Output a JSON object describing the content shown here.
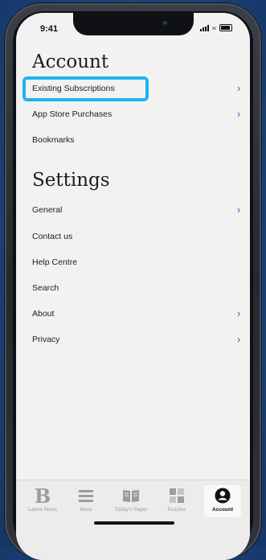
{
  "status_bar": {
    "time": "9:41"
  },
  "account": {
    "heading": "Account",
    "items": [
      {
        "label": "Existing Subscriptions",
        "chevron": "›",
        "has_chevron": true
      },
      {
        "label": "App Store Purchases",
        "chevron": "›",
        "has_chevron": true
      },
      {
        "label": "Bookmarks",
        "has_chevron": false
      }
    ]
  },
  "settings": {
    "heading": "Settings",
    "items": [
      {
        "label": "General",
        "chevron": "›",
        "has_chevron": true
      },
      {
        "label": "Contact us",
        "has_chevron": false
      },
      {
        "label": "Help Centre",
        "has_chevron": false
      },
      {
        "label": "Search",
        "has_chevron": false
      },
      {
        "label": "About",
        "chevron": "›",
        "has_chevron": true
      },
      {
        "label": "Privacy",
        "chevron": "›",
        "has_chevron": true
      }
    ]
  },
  "tab_bar": {
    "tabs": [
      {
        "label": "Latest News",
        "icon": "b-logo-icon",
        "glyph": "B",
        "active": false
      },
      {
        "label": "More",
        "icon": "hamburger-menu-icon",
        "active": false
      },
      {
        "label": "Today's Paper",
        "icon": "open-book-icon",
        "active": false
      },
      {
        "label": "Puzzles",
        "icon": "puzzle-grid-icon",
        "active": false
      },
      {
        "label": "Account",
        "icon": "user-circle-icon",
        "active": true
      }
    ]
  },
  "colors": {
    "accent_chevron": "#2a6bd1",
    "highlight_border": "#1fb4f0",
    "background": "#1f4780"
  }
}
